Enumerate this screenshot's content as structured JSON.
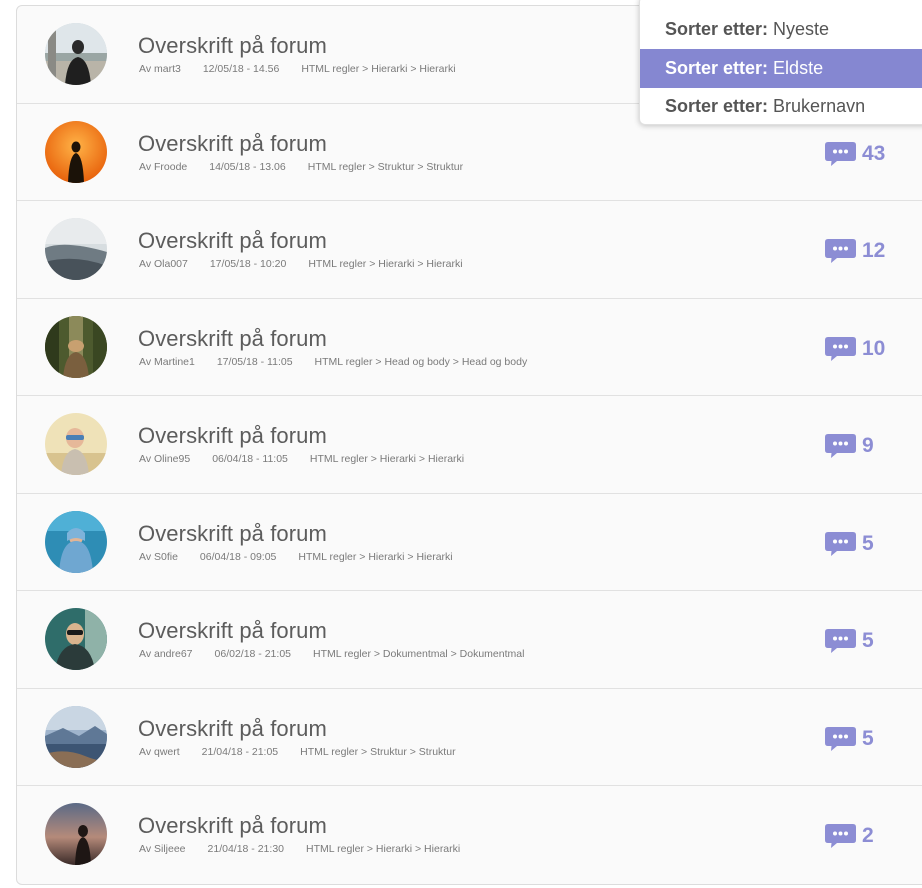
{
  "colors": {
    "accent": "#8c8dd4",
    "selected_bg": "#8587d1",
    "text": "#5c5c5c",
    "meta": "#7a7a7a"
  },
  "sort_menu": {
    "options": [
      {
        "prefix": "Sorter etter:",
        "value": "Nyeste",
        "selected": false
      },
      {
        "prefix": "Sorter etter:",
        "value": "Eldste",
        "selected": true
      },
      {
        "prefix": "Sorter etter:",
        "value": "Brukernavn",
        "selected": false
      }
    ]
  },
  "threads": [
    {
      "title": "Overskrift på forum",
      "author": "Av mart3",
      "date": "12/05/18 - 14.56",
      "path": "HTML regler > Hierarki > Hierarki",
      "replies": "",
      "icon": "chat-bubble-icon"
    },
    {
      "title": "Overskrift på forum",
      "author": "Av Froode",
      "date": "14/05/18 - 13.06",
      "path": "HTML regler > Struktur > Struktur",
      "replies": "43",
      "icon": "chat-bubble-icon"
    },
    {
      "title": "Overskrift på forum",
      "author": "Av Ola007",
      "date": "17/05/18 - 10:20",
      "path": "HTML regler > Hierarki > Hierarki",
      "replies": "12",
      "icon": "chat-bubble-icon"
    },
    {
      "title": "Overskrift på forum",
      "author": "Av Martine1",
      "date": "17/05/18 - 11:05",
      "path": "HTML regler > Head og body > Head og body",
      "replies": "10",
      "icon": "chat-bubble-icon"
    },
    {
      "title": "Overskrift på forum",
      "author": "Av Oline95",
      "date": "06/04/18 - 11:05",
      "path": "HTML regler > Hierarki > Hierarki",
      "replies": "9",
      "icon": "chat-bubble-icon"
    },
    {
      "title": "Overskrift på forum",
      "author": "Av S0fie",
      "date": "06/04/18 - 09:05",
      "path": "HTML regler > Hierarki > Hierarki",
      "replies": "5",
      "icon": "chat-bubble-icon"
    },
    {
      "title": "Overskrift på forum",
      "author": "Av andre67",
      "date": "06/02/18 - 21:05",
      "path": "HTML regler > Dokumentmal > Dokumentmal",
      "replies": "5",
      "icon": "chat-bubble-icon"
    },
    {
      "title": "Overskrift på forum",
      "author": "Av qwert",
      "date": "21/04/18 - 21:05",
      "path": "HTML regler > Struktur > Struktur",
      "replies": "5",
      "icon": "chat-bubble-icon"
    },
    {
      "title": "Overskrift på forum",
      "author": "Av Siljeee",
      "date": "21/04/18 - 21:30",
      "path": "HTML regler > Hierarki > Hierarki",
      "replies": "2",
      "icon": "chat-bubble-icon"
    }
  ]
}
